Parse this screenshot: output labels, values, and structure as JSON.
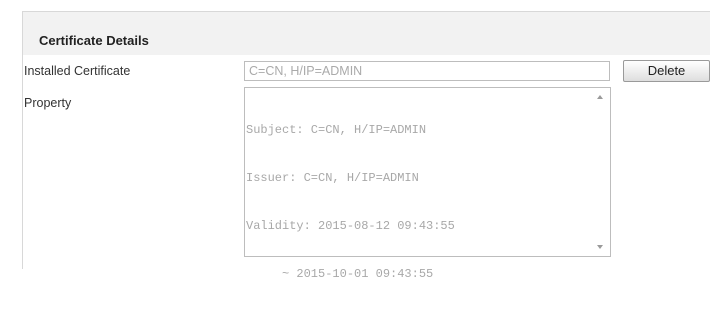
{
  "section": {
    "title": "Certificate Details"
  },
  "installed_certificate": {
    "label": "Installed Certificate",
    "value": "C=CN, H/IP=ADMIN",
    "delete_label": "Delete"
  },
  "property": {
    "label": "Property",
    "lines": [
      "Subject: C=CN, H/IP=ADMIN",
      "Issuer: C=CN, H/IP=ADMIN",
      "Validity: 2015-08-12 09:43:55",
      "     ~ 2015-10-01 09:43:55"
    ]
  },
  "scrollbar": {
    "up_icon": "triangle-up",
    "down_icon": "triangle-down"
  },
  "colors": {
    "header_bg": "#f2f2f2",
    "field_text": "#aaaaaa",
    "border": "#bdbdbd"
  }
}
